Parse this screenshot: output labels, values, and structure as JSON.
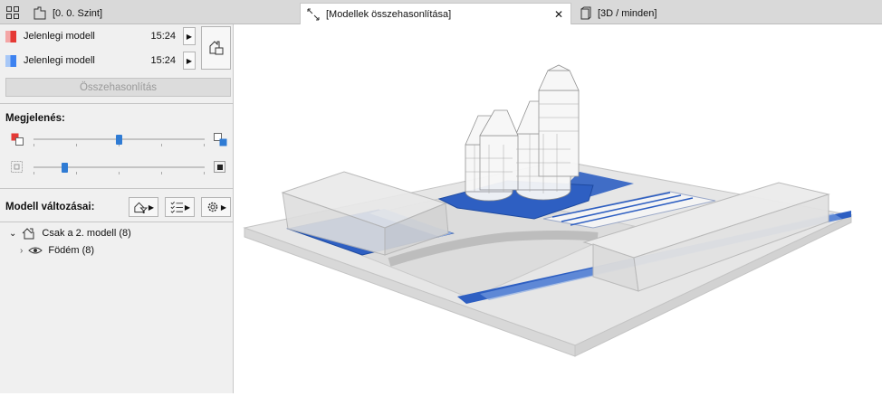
{
  "tabs": [
    {
      "label": "[0. 0. Szint]",
      "icon": "floor-plan-icon"
    },
    {
      "label": "[Modellek összehasonlítása]",
      "icon": "compare-arrows-icon",
      "close": "✕"
    },
    {
      "label": "[3D / minden]",
      "icon": "3d-box-icon"
    }
  ],
  "models": [
    {
      "name": "Jelenlegi modell",
      "time": "15:24",
      "color": "#e53935"
    },
    {
      "name": "Jelenlegi modell",
      "time": "15:24",
      "color": "#3d82f0"
    }
  ],
  "compare_label": "Összehasonlítás",
  "appearance": {
    "title": "Megjelenés:",
    "color_balance": 0.5,
    "transparency": 0.18
  },
  "changes": {
    "title": "Modell változásai:",
    "tree": [
      {
        "label": "Csak a 2. modell (8)",
        "expanded": true
      },
      {
        "label": "Födém (8)",
        "expanded": false
      }
    ]
  },
  "colors": {
    "accent": "#2f7bd4",
    "model1": "#e53935",
    "model2": "#3d82f0",
    "slab_blue": "#2e5fc2"
  }
}
